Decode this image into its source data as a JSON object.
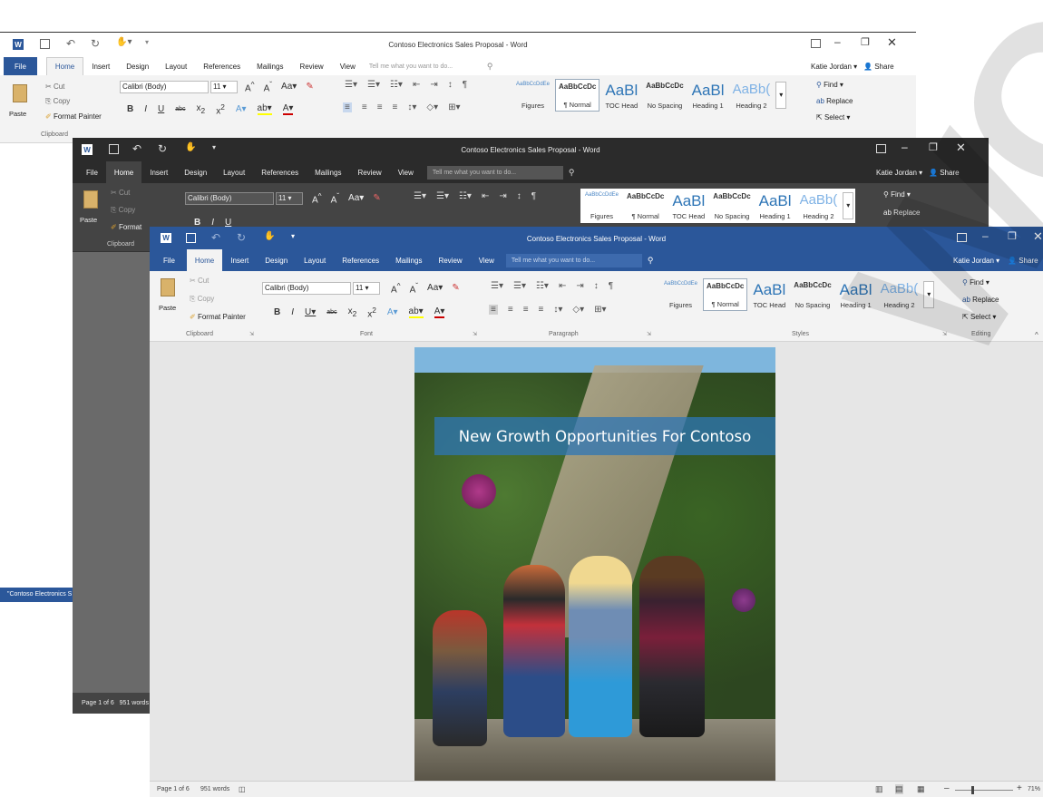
{
  "app_title": "Contoso Electronics Sales Proposal - Word",
  "search_placeholder": "Tell me what you want to do...",
  "user": "Katie Jordan",
  "share": "Share",
  "tabs": [
    "File",
    "Home",
    "Insert",
    "Design",
    "Layout",
    "References",
    "Mailings",
    "Review",
    "View"
  ],
  "clipboard": {
    "paste": "Paste",
    "cut": "Cut",
    "copy": "Copy",
    "format_painter": "Format Painter",
    "format_painter_short": "Format",
    "group": "Clipboard"
  },
  "font": {
    "name": "Calibri (Body)",
    "size": "11",
    "group": "Font"
  },
  "paragraph": {
    "group": "Paragraph"
  },
  "styles": {
    "group": "Styles",
    "items": [
      {
        "preview": "AaBbCcDdEe",
        "name": "Figures"
      },
      {
        "preview": "AaBbCcDc",
        "name": "¶ Normal"
      },
      {
        "preview": "AaBl",
        "name": "TOC Head"
      },
      {
        "preview": "AaBbCcDc",
        "name": "No Spacing"
      },
      {
        "preview": "AaBl",
        "name": "Heading 1"
      },
      {
        "preview": "AaBb(",
        "name": "Heading 2"
      }
    ]
  },
  "editing": {
    "find": "Find",
    "replace": "Replace",
    "select": "Select",
    "group": "Editing"
  },
  "document": {
    "cover_title": "New Growth Opportunities For Contoso"
  },
  "status": {
    "page": "Page 1 of 6",
    "words": "951 words",
    "zoom": "71%",
    "side_doc": "\"Contoso Electronics S"
  },
  "watermark": "WORK",
  "colors": {
    "word_blue": "#2b579a",
    "dark_title": "#2b2b2b",
    "dark_ribbon": "#444444",
    "dark_body": "#6a6a6a",
    "light_ribbon": "#f3f3f3",
    "doc_bg": "#e6e6e6"
  }
}
